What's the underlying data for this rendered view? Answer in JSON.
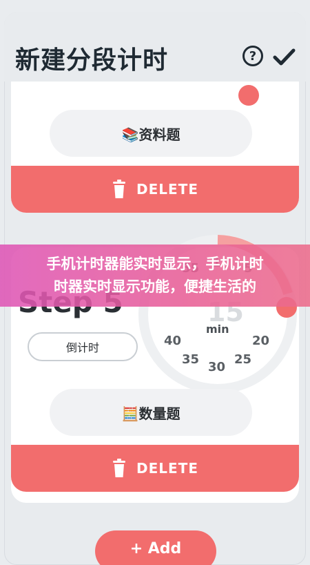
{
  "header": {
    "title": "新建分段计时",
    "help_label": "?"
  },
  "cards": [
    {
      "category_label": "📚资料题",
      "delete_label": "DELETE"
    },
    {
      "step_label": "Step 5",
      "mode_button": "倒计时",
      "category_label": "🧮数量题",
      "delete_label": "DELETE",
      "timer": {
        "center_value": "15",
        "unit": "min",
        "ticks": [
          "55",
          "1",
          "5",
          "40",
          "20",
          "35",
          "25",
          "30"
        ]
      }
    }
  ],
  "add_button": {
    "label": "+ Add"
  },
  "banner": {
    "line1": "手机计时器能实时显示，手机计时",
    "line2": "时器实时显示功能，便捷生活的"
  },
  "colors": {
    "accent": "#f26d6d",
    "background": "#e8ebee",
    "banner": "#e05ab4"
  },
  "icons": [
    "help-icon",
    "check-icon",
    "trash-icon"
  ]
}
